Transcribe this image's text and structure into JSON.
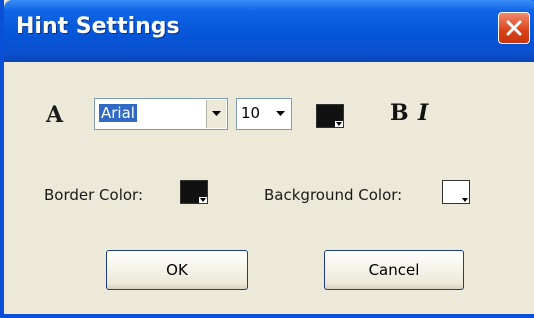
{
  "window": {
    "title": "Hint Settings"
  },
  "font": {
    "name": "Arial",
    "size": "10",
    "text_color": "#111111",
    "bold_label": "B",
    "italic_label": "I",
    "font_icon_glyph": "A"
  },
  "colors": {
    "border_label": "Border Color:",
    "border_color": "#111111",
    "background_label": "Background Color:",
    "background_color": "#ffffff"
  },
  "buttons": {
    "ok_label": "OK",
    "cancel_label": "Cancel"
  },
  "accent": {
    "title_bar": "#0556d8",
    "close_button": "#d8421a",
    "selection": "#316ac5"
  }
}
